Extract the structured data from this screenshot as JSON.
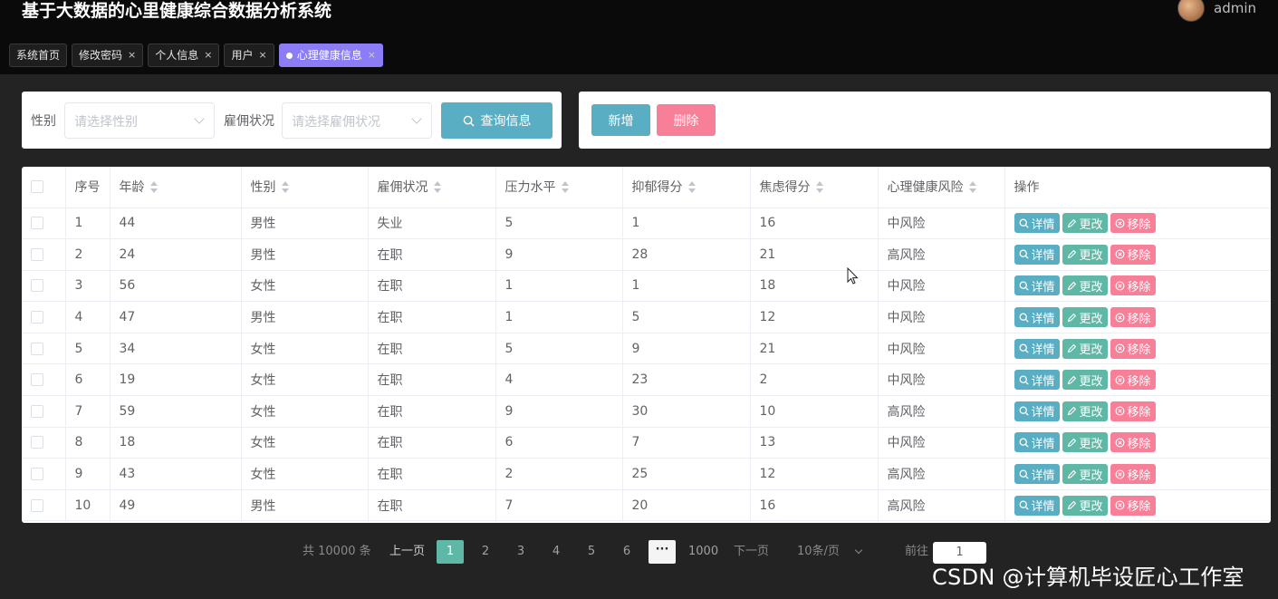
{
  "app": {
    "title": "基于大数据的心里健康综合数据分析系统",
    "username": "admin"
  },
  "tabs": [
    {
      "label": "系统首页",
      "closable": false,
      "active": false
    },
    {
      "label": "修改密码",
      "closable": true,
      "active": false
    },
    {
      "label": "个人信息",
      "closable": true,
      "active": false
    },
    {
      "label": "用户",
      "closable": true,
      "active": false
    },
    {
      "label": "心理健康信息",
      "closable": true,
      "active": true
    }
  ],
  "close_glyph": "×",
  "search": {
    "gender_label": "性别",
    "gender_placeholder": "请选择性别",
    "employment_label": "雇佣状况",
    "employment_placeholder": "请选择雇佣状况",
    "search_button": "查询信息"
  },
  "actions": {
    "add": "新增",
    "delete": "删除"
  },
  "table": {
    "columns": [
      "序号",
      "年龄",
      "性别",
      "雇佣状况",
      "压力水平",
      "抑郁得分",
      "焦虑得分",
      "心理健康风险",
      "操作"
    ],
    "row_actions": {
      "detail": "详情",
      "edit": "更改",
      "remove": "移除"
    },
    "rows": [
      [
        "1",
        "44",
        "男性",
        "失业",
        "5",
        "1",
        "16",
        "中风险"
      ],
      [
        "2",
        "24",
        "男性",
        "在职",
        "9",
        "28",
        "21",
        "高风险"
      ],
      [
        "3",
        "56",
        "女性",
        "在职",
        "1",
        "1",
        "18",
        "中风险"
      ],
      [
        "4",
        "47",
        "男性",
        "在职",
        "1",
        "5",
        "12",
        "中风险"
      ],
      [
        "5",
        "34",
        "女性",
        "在职",
        "5",
        "9",
        "21",
        "中风险"
      ],
      [
        "6",
        "19",
        "女性",
        "在职",
        "4",
        "23",
        "2",
        "中风险"
      ],
      [
        "7",
        "59",
        "女性",
        "在职",
        "9",
        "30",
        "10",
        "高风险"
      ],
      [
        "8",
        "18",
        "女性",
        "在职",
        "6",
        "7",
        "13",
        "中风险"
      ],
      [
        "9",
        "43",
        "女性",
        "在职",
        "2",
        "25",
        "12",
        "高风险"
      ],
      [
        "10",
        "49",
        "男性",
        "在职",
        "7",
        "20",
        "16",
        "高风险"
      ]
    ]
  },
  "pagination": {
    "total": "共 10000 条",
    "prev": "上一页",
    "pages": [
      "1",
      "2",
      "3",
      "4",
      "5",
      "6"
    ],
    "current": "1",
    "more": "···",
    "last": "1000",
    "next": "下一页",
    "page_size": "10条/页",
    "goto_label": "前往",
    "goto_value": "1"
  },
  "watermark": "CSDN @计算机毕设匠心工作室",
  "colors": {
    "accent": "#5aaec4",
    "edit": "#5fb8a6",
    "danger": "#f77f98",
    "active_tab": "#8c7cf5"
  }
}
